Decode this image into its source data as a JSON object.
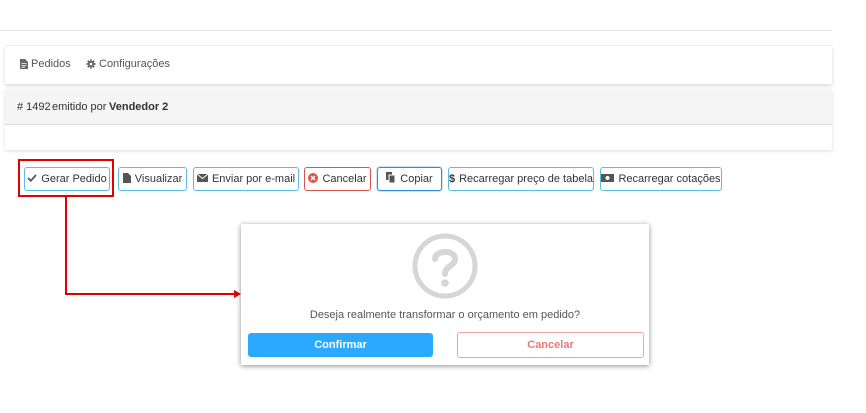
{
  "tabs": [
    {
      "label": "Pedidos",
      "icon": "document-icon"
    },
    {
      "label": "Configurações",
      "icon": "gear-icon"
    }
  ],
  "order": {
    "number": "# 1492",
    "emitted_by_label": "emitido por",
    "seller": "Vendedor 2"
  },
  "toolbar": {
    "gerar_pedido": "Gerar Pedido",
    "visualizar": "Visualizar",
    "enviar_email": "Enviar por e-mail",
    "cancelar": "Cancelar",
    "copiar": "Copiar",
    "recarregar_preco": "Recarregar preço de tabela",
    "recarregar_cotacoes": "Recarregar cotações"
  },
  "modal": {
    "message": "Deseja realmente transformar o orçamento em pedido?",
    "confirm_label": "Confirmar",
    "cancel_label": "Cancelar"
  },
  "colors": {
    "annotation": "#e00000",
    "info_border": "#5bc0de",
    "danger": "#d9534f",
    "confirm": "#2aa9ff",
    "cancel_text": "#e87878"
  }
}
